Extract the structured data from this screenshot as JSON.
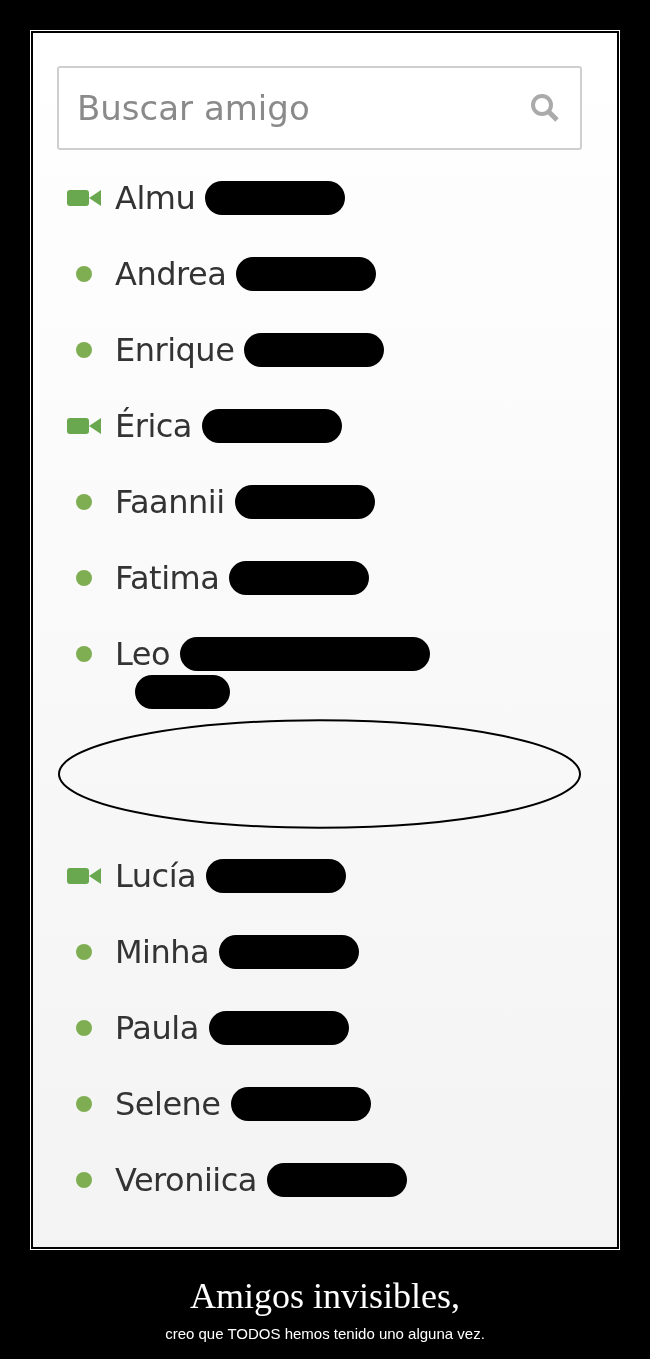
{
  "search": {
    "placeholder": "Buscar amigo"
  },
  "friends": [
    {
      "name": "Almu",
      "kind": "video",
      "wrapped": false
    },
    {
      "name": "Andrea",
      "kind": "online",
      "wrapped": false
    },
    {
      "name": "Enrique",
      "kind": "online",
      "wrapped": false
    },
    {
      "name": "Érica",
      "kind": "video",
      "wrapped": false
    },
    {
      "name": "Faannii",
      "kind": "online",
      "wrapped": false
    },
    {
      "name": "Fatima",
      "kind": "online",
      "wrapped": false
    },
    {
      "name": "Leo",
      "kind": "online",
      "wrapped": true
    }
  ],
  "friends_after_gap": [
    {
      "name": "Lucía",
      "kind": "video",
      "wrapped": false
    },
    {
      "name": "Minha",
      "kind": "online",
      "wrapped": false
    },
    {
      "name": "Paula",
      "kind": "online",
      "wrapped": false
    },
    {
      "name": "Selene",
      "kind": "online",
      "wrapped": false
    },
    {
      "name": "Veroniica",
      "kind": "online",
      "wrapped": false
    }
  ],
  "caption": {
    "title": "Amigos invisibles,",
    "subtitle": "creo que TODOS hemos tenido uno alguna vez."
  }
}
